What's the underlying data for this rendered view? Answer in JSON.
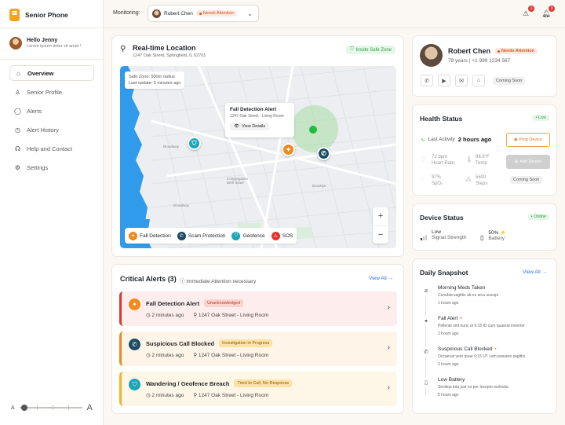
{
  "app": {
    "name": "Senior Phone"
  },
  "user": {
    "name": "Hello Jenny",
    "subtitle": "Lorem ipsum dolor sit amet !"
  },
  "nav": [
    {
      "label": "Overview",
      "icon": "home-icon"
    },
    {
      "label": "Senior Profile",
      "icon": "user-icon"
    },
    {
      "label": "Alerts",
      "icon": "alert-icon"
    },
    {
      "label": "Alert History",
      "icon": "history-icon"
    },
    {
      "label": "Help and Contact",
      "icon": "headset-icon"
    },
    {
      "label": "Settings",
      "icon": "gear-icon"
    }
  ],
  "text_size": {
    "small": "A",
    "large": "A"
  },
  "topbar": {
    "monitoring_label": "Monitoring:",
    "selected_name": "Robert Chen",
    "selected_status": "Needs Attention",
    "notif_count_1": "1",
    "notif_count_2": "3"
  },
  "location": {
    "title": "Real-time Location",
    "address": "1247 Oak Street, Springfield, IL 62701",
    "safe_badge": "Inside Safe Zone",
    "info_line1": "Safe Zone: 500m radius",
    "info_line2": "Last update: 5 minutes ago",
    "popup_title": "Fall Detection Alert",
    "popup_address": "1247 Oak Street - Living Room",
    "popup_button": "View Details",
    "zoom_in": "+",
    "zoom_out": "−",
    "map_labels": [
      "Broadway",
      "Congregation Beth Israel",
      "Brooklyn",
      "Broadway"
    ],
    "legend": [
      {
        "label": "Fall Detection",
        "color": "#f08a1c"
      },
      {
        "label": "Scam Protection",
        "color": "#1d4a63"
      },
      {
        "label": "Geofence",
        "color": "#1aa4b8"
      },
      {
        "label": "SOS",
        "color": "#e0352a"
      }
    ]
  },
  "critical": {
    "title": "Critical Alerts (3)",
    "note": "Immediate Attention necessary",
    "view_all": "View All →",
    "alerts": [
      {
        "title": "Fall Detection Alert",
        "badge": "Unacknowledged",
        "time": "2 minutes ago",
        "place": "1247 Oak Street - Living Room"
      },
      {
        "title": "Suspicious Call Blocked",
        "badge": "Investigation in Progress",
        "time": "2 minutes ago",
        "place": "1247 Oak Street - Living Room"
      },
      {
        "title": "Wandering / Geofence Breach",
        "badge": "Tried to Call, No Response",
        "time": "2 minutes ago",
        "place": "1247 Oak Street - Living Room"
      }
    ]
  },
  "profile": {
    "name": "Robert Chen",
    "status": "Needs Attention",
    "sub": "78 years | +1 999 1234 567",
    "coming_soon": "Coming Soon"
  },
  "health": {
    "title": "Health Status",
    "live": "• Live",
    "last_activity_label": "Last Activity",
    "last_activity_value": "2 hours ago",
    "ping": "Ping Device",
    "add": "Add Device",
    "heart_value": "72 bpm",
    "heart_label": "Heart Rate",
    "temp_value": "98.6°F",
    "temp_label": "Temp",
    "spo2_value": "97%",
    "spo2_label": "SpO₂",
    "steps_value": "5600",
    "steps_label": "Steps",
    "coming_soon": "Coming Soon"
  },
  "device": {
    "title": "Device Status",
    "online": "• Online",
    "signal_value": "Low",
    "signal_label": "Signal Strength",
    "battery_value": "50%",
    "battery_label": "Battery"
  },
  "snapshot": {
    "title": "Daily Snapshot",
    "view_all": "View All →",
    "items": [
      {
        "title": "Morning Meds Taken",
        "desc": "Conubia sagittis ab ex arcu suscipi",
        "time": "1 hours ago",
        "dot": ""
      },
      {
        "title": "Fall Alert",
        "desc": "Pellente sint nunc ut 9:15 ID cum quaerat inventor",
        "time": "2 hours ago",
        "dot": "•"
      },
      {
        "title": "Suspicious Call Blocked",
        "desc": "Occaecat vero quae 9:15 UT cum posuere sagittis",
        "time": "3 hours ago",
        "dot": "•"
      },
      {
        "title": "Low Battery",
        "desc": "Similiqu tota just no per Incepto molestia",
        "time": "5 hours ago",
        "dot": ""
      }
    ]
  }
}
